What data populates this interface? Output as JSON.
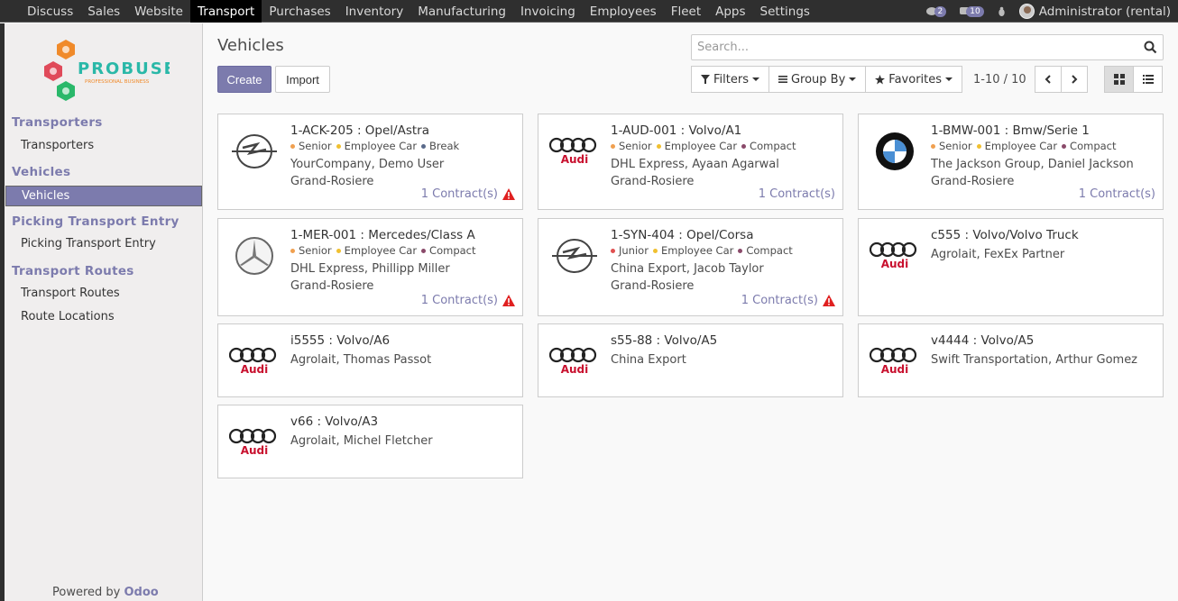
{
  "topbar": {
    "menu": [
      "Discuss",
      "Sales",
      "Website",
      "Transport",
      "Purchases",
      "Inventory",
      "Manufacturing",
      "Invoicing",
      "Employees",
      "Fleet",
      "Apps",
      "Settings"
    ],
    "active_index": 3,
    "chat_count": "2",
    "activity_count": "10",
    "user": "Administrator (rental)"
  },
  "sidebar": {
    "logo_text": "PROBUSE",
    "logo_subtext": "PROFESSIONAL BUSINESS",
    "sections": [
      {
        "title": "Transporters",
        "items": [
          "Transporters"
        ]
      },
      {
        "title": "Vehicles",
        "items": [
          "Vehicles"
        ]
      },
      {
        "title": "Picking Transport Entry",
        "items": [
          "Picking Transport Entry"
        ]
      },
      {
        "title": "Transport Routes",
        "items": [
          "Transport Routes",
          "Route Locations"
        ]
      }
    ],
    "active_item": "Vehicles",
    "powered_by": "Powered by",
    "powered_brand": "Odoo"
  },
  "control": {
    "title": "Vehicles",
    "create_label": "Create",
    "import_label": "Import",
    "search_placeholder": "Search...",
    "filters_label": "Filters",
    "groupby_label": "Group By",
    "favorites_label": "Favorites",
    "pager": "1-10 / 10"
  },
  "tag_colors": {
    "Senior": "#f0a050",
    "Junior": "#e05050",
    "Employee Car": "#f0c030",
    "Break": "#5a6a8a",
    "Compact": "#8a4a6a"
  },
  "cards": [
    {
      "name": "1-ACK-205 : Opel/Astra",
      "brand": "opel",
      "tags": [
        "Senior",
        "Employee Car",
        "Break"
      ],
      "line1": "YourCompany, Demo User",
      "line2": "Grand-Rosiere",
      "contract": "1 Contract(s)",
      "warn": true
    },
    {
      "name": "1-AUD-001 : Volvo/A1",
      "brand": "audi",
      "tags": [
        "Senior",
        "Employee Car",
        "Compact"
      ],
      "line1": "DHL Express, Ayaan Agarwal",
      "line2": "Grand-Rosiere",
      "contract": "1 Contract(s)",
      "warn": false
    },
    {
      "name": "1-BMW-001 : Bmw/Serie 1",
      "brand": "bmw",
      "tags": [
        "Senior",
        "Employee Car",
        "Compact"
      ],
      "line1": "The Jackson Group, Daniel Jackson",
      "line2": "Grand-Rosiere",
      "contract": "1 Contract(s)",
      "warn": false
    },
    {
      "name": "1-MER-001 : Mercedes/Class A",
      "brand": "mercedes",
      "tags": [
        "Senior",
        "Employee Car",
        "Compact"
      ],
      "line1": "DHL Express, Phillipp Miller",
      "line2": "Grand-Rosiere",
      "contract": "1 Contract(s)",
      "warn": true
    },
    {
      "name": "1-SYN-404 : Opel/Corsa",
      "brand": "opel",
      "tags": [
        "Junior",
        "Employee Car",
        "Compact"
      ],
      "line1": "China Export, Jacob Taylor",
      "line2": "Grand-Rosiere",
      "contract": "1 Contract(s)",
      "warn": true
    },
    {
      "name": "c555 : Volvo/Volvo Truck",
      "brand": "audi",
      "tags": [],
      "line1": "Agrolait, FexEx Partner",
      "line2": "",
      "contract": "",
      "warn": false
    },
    {
      "name": "i5555 : Volvo/A6",
      "brand": "audi",
      "tags": [],
      "line1": "Agrolait, Thomas Passot",
      "line2": "",
      "contract": "",
      "warn": false
    },
    {
      "name": "s55-88 : Volvo/A5",
      "brand": "audi",
      "tags": [],
      "line1": "China Export",
      "line2": "",
      "contract": "",
      "warn": false
    },
    {
      "name": "v4444 : Volvo/A5",
      "brand": "audi",
      "tags": [],
      "line1": "Swift Transportation, Arthur Gomez",
      "line2": "",
      "contract": "",
      "warn": false
    },
    {
      "name": "v66 : Volvo/A3",
      "brand": "audi",
      "tags": [],
      "line1": "Agrolait, Michel Fletcher",
      "line2": "",
      "contract": "",
      "warn": false
    }
  ]
}
